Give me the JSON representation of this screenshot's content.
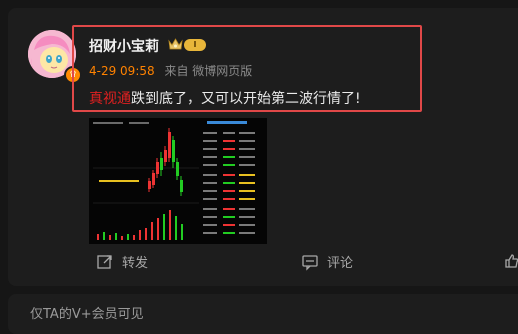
{
  "post": {
    "author": "招财小宝莉",
    "level_badge": "I",
    "time": "4-29 09:58",
    "source": "来自 微博网页版",
    "text_tag": "真视通",
    "text_body": "跌到底了，又可以开始第二波行情了!"
  },
  "actions": {
    "repost": "转发",
    "comment": "评论"
  },
  "footer": {
    "notice": "仅TA的V+会员可见"
  },
  "colors": {
    "background": "#161616",
    "card": "#1d1d1d",
    "highlight": "#e04848",
    "time": "#ff8200",
    "tag": "#e02020"
  }
}
